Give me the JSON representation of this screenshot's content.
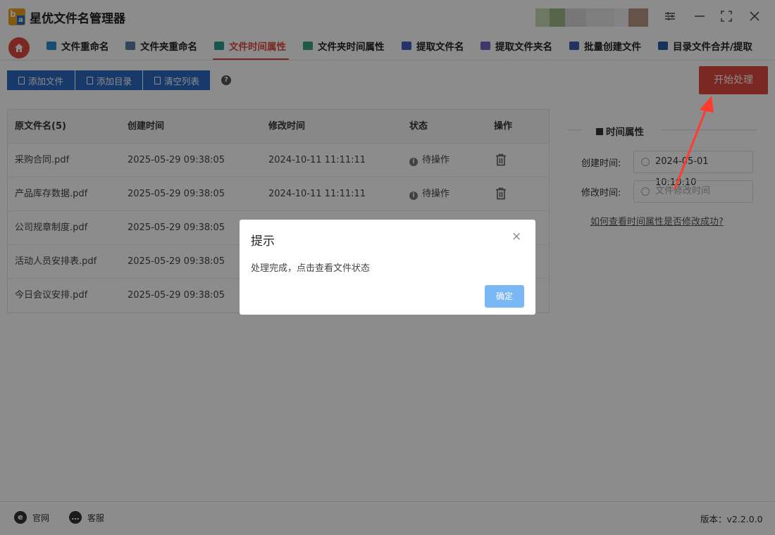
{
  "app": {
    "title": "星优文件名管理器"
  },
  "tabs": [
    {
      "label": "文件重命名",
      "icon": "file-rename-icon",
      "color": "#2b8fd0"
    },
    {
      "label": "文件夹重命名",
      "icon": "folder-rename-icon",
      "color": "#5b7fa8"
    },
    {
      "label": "文件时间属性",
      "icon": "file-time-icon",
      "color": "#2a9d8f",
      "active": true
    },
    {
      "label": "文件夹时间属性",
      "icon": "folder-time-icon",
      "color": "#3aa388"
    },
    {
      "label": "提取文件名",
      "icon": "extract-filename-icon",
      "color": "#3f5fc4"
    },
    {
      "label": "提取文件夹名",
      "icon": "extract-foldername-icon",
      "color": "#7b5fc4"
    },
    {
      "label": "批量创建文件",
      "icon": "batch-create-icon",
      "color": "#3d5fb0"
    },
    {
      "label": "目录文件合并/提取",
      "icon": "merge-extract-icon",
      "color": "#2a5fa0"
    }
  ],
  "toolbar": {
    "add_file": "添加文件",
    "add_dir": "添加目录",
    "clear_list": "清空列表",
    "help": "?",
    "start": "开始处理"
  },
  "table": {
    "headers": {
      "name": "原文件名(5)",
      "created": "创建时间",
      "modified": "修改时间",
      "status": "状态",
      "action": "操作"
    },
    "rows": [
      {
        "name": "采购合同.pdf",
        "created": "2025-05-29 09:38:05",
        "modified": "2024-10-11 11:11:11",
        "status": "待操作"
      },
      {
        "name": "产品库存数据.pdf",
        "created": "2025-05-29 09:38:05",
        "modified": "2024-10-11 11:11:11",
        "status": "待操作"
      },
      {
        "name": "公司规章制度.pdf",
        "created": "2025-05-29 09:38:05",
        "modified": "",
        "status": ""
      },
      {
        "name": "活动人员安排表.pdf",
        "created": "2025-05-29 09:38:05",
        "modified": "",
        "status": ""
      },
      {
        "name": "今日会议安排.pdf",
        "created": "2025-05-29 09:38:05",
        "modified": "",
        "status": ""
      }
    ]
  },
  "panel": {
    "title": "时间属性",
    "created_label": "创建时间:",
    "created_value": "2024-05-01 10:10:10",
    "modified_label": "修改时间:",
    "modified_placeholder": "文件修改时间",
    "help_link": "如何查看时间属性是否修改成功?"
  },
  "footer": {
    "website": "官网",
    "support": "客服",
    "version": "版本：v2.2.0.0"
  },
  "modal": {
    "title": "提示",
    "close": "×",
    "message": "处理完成，点击查看文件状态",
    "ok": "确定"
  },
  "colors": {
    "accent_red": "#e0483e",
    "toolbar_blue": "#2a6bc4",
    "ok_button": "#7ab8f5"
  }
}
